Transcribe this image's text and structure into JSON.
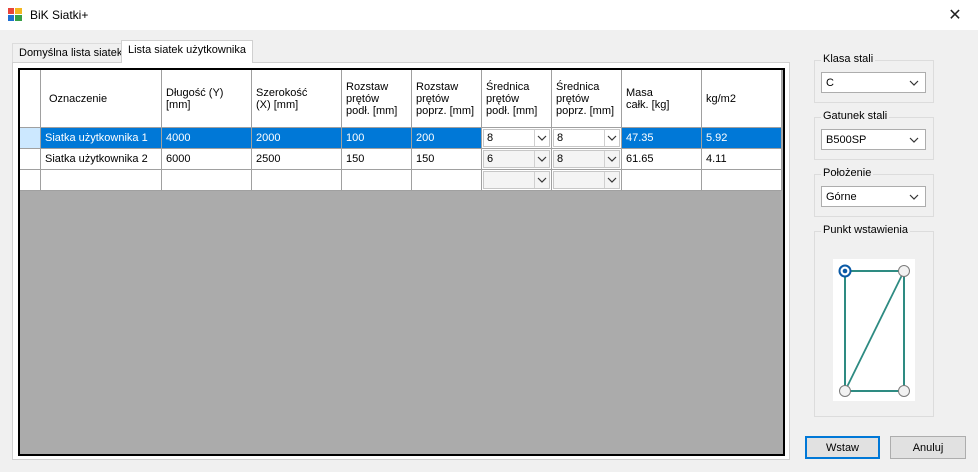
{
  "window": {
    "title": "BiK Siatki+",
    "close_glyph": "✕"
  },
  "tabs": [
    {
      "label": "Domyślna lista siatek",
      "active": false
    },
    {
      "label": "Lista siatek użytkownika",
      "active": true
    }
  ],
  "grid": {
    "columns": [
      "Oznaczenie",
      "Długość (Y)\n[mm]",
      "Szerokość\n(X) [mm]",
      "Rozstaw\nprętów\npodł. [mm]",
      "Rozstaw\nprętów\npoprz. [mm]",
      "Średnica\nprętów\npodł. [mm]",
      "Średnica\nprętów\npoprz. [mm]",
      "Masa\ncałk. [kg]",
      "kg/m2"
    ],
    "rows": [
      {
        "name": "Siatka użytkownika 1",
        "length": "4000",
        "width": "2000",
        "spacing_long": "100",
        "spacing_cross": "200",
        "dia_long": "8",
        "dia_cross": "8",
        "mass": "47.35",
        "kgm2": "5.92",
        "selected": true
      },
      {
        "name": "Siatka użytkownika 2",
        "length": "6000",
        "width": "2500",
        "spacing_long": "150",
        "spacing_cross": "150",
        "dia_long": "6",
        "dia_cross": "8",
        "mass": "61.65",
        "kgm2": "4.11",
        "selected": false
      },
      {
        "name": "",
        "length": "",
        "width": "",
        "spacing_long": "",
        "spacing_cross": "",
        "dia_long": "",
        "dia_cross": "",
        "mass": "",
        "kgm2": "",
        "selected": false
      }
    ]
  },
  "settings": {
    "steel_class": {
      "label": "Klasa stali",
      "value": "C"
    },
    "steel_grade": {
      "label": "Gatunek stali",
      "value": "B500SP"
    },
    "position": {
      "label": "Położenie",
      "value": "Górne"
    },
    "insertion_point": {
      "label": "Punkt wstawienia",
      "selected_corner": "top-left"
    }
  },
  "buttons": {
    "insert": "Wstaw",
    "cancel": "Anuluj"
  },
  "colors": {
    "selection": "#0078d7",
    "grid_background": "#ababab",
    "diagram_line": "#2e8b82",
    "radio_selected": "#0a5aa6"
  }
}
